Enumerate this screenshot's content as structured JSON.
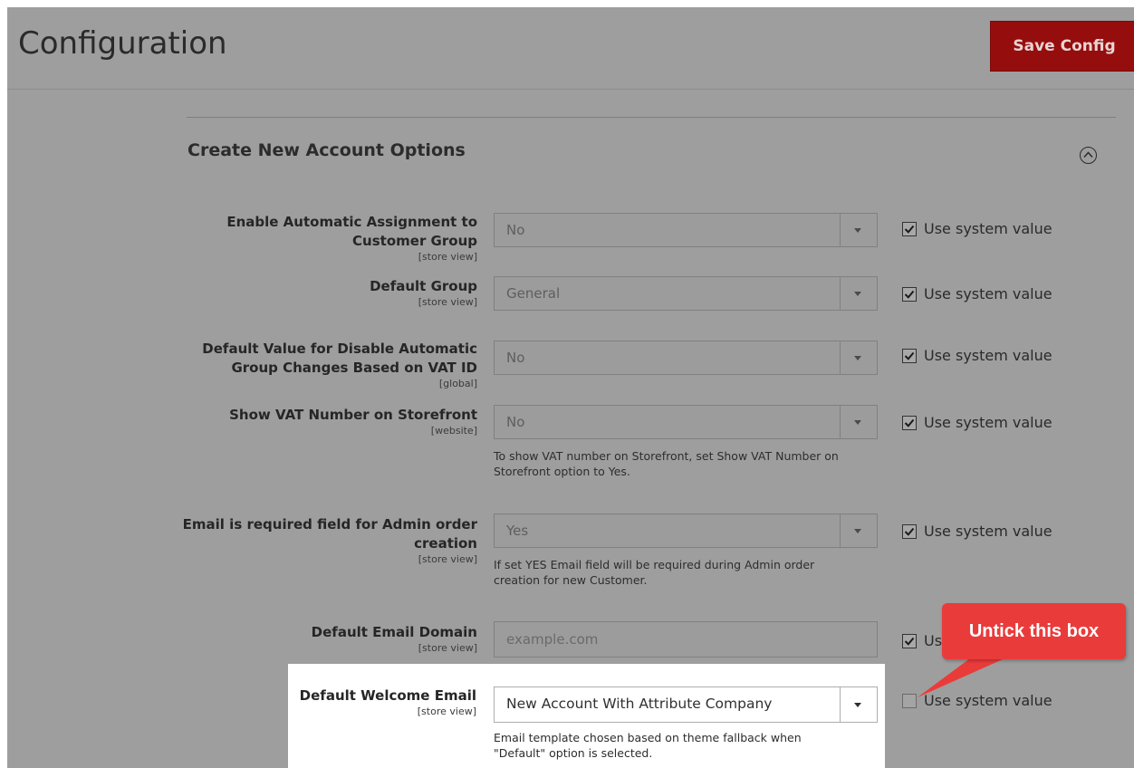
{
  "header": {
    "title": "Configuration",
    "save_button": "Save Config"
  },
  "section": {
    "title": "Create New Account Options",
    "collapse_icon": "chevron-up-circle-icon"
  },
  "fields": [
    {
      "label_lines": [
        "Enable Automatic Assignment to",
        "Customer Group"
      ],
      "scope": "[store view]",
      "value": "No",
      "use_system_value": "Use system value",
      "use_system_checked": true
    },
    {
      "label_lines": [
        "Default Group"
      ],
      "scope": "[store view]",
      "value": "General",
      "use_system_value": "Use system value",
      "use_system_checked": true
    },
    {
      "label_lines": [
        "Default Value for Disable Automatic",
        "Group Changes Based on VAT ID"
      ],
      "scope": "[global]",
      "value": "No",
      "use_system_value": "Use system value",
      "use_system_checked": true
    },
    {
      "label_lines": [
        "Show VAT Number on Storefront"
      ],
      "scope": "[website]",
      "value": "No",
      "note": [
        "To show VAT number on Storefront, set Show VAT Number on",
        "Storefront option to Yes."
      ],
      "use_system_value": "Use system value",
      "use_system_checked": true
    },
    {
      "label_lines": [
        "Email is required field for Admin order",
        "creation"
      ],
      "scope": "[store view]",
      "value": "Yes",
      "note": [
        "If set YES Email field will be required during Admin order",
        "creation for new Customer."
      ],
      "use_system_value": "Use system value",
      "use_system_checked": true
    },
    {
      "label_lines": [
        "Default Email Domain"
      ],
      "scope": "[store view]",
      "value": "example.com",
      "use_system_value": "Us",
      "use_system_checked": true
    },
    {
      "label_lines": [
        "Default Welcome Email"
      ],
      "scope": "[store view]",
      "value": "New Account With Attribute Company",
      "note": [
        "Email template chosen based on theme fallback when",
        "\"Default\" option is selected."
      ],
      "use_system_value": "Use system value",
      "use_system_checked": false
    }
  ],
  "callout": {
    "text": "Untick this box",
    "color": "#ea3b3b"
  },
  "colors": {
    "save_button": "#960d0d",
    "overlay_gray": "#9e9e9e",
    "highlight": "#ffffff"
  }
}
